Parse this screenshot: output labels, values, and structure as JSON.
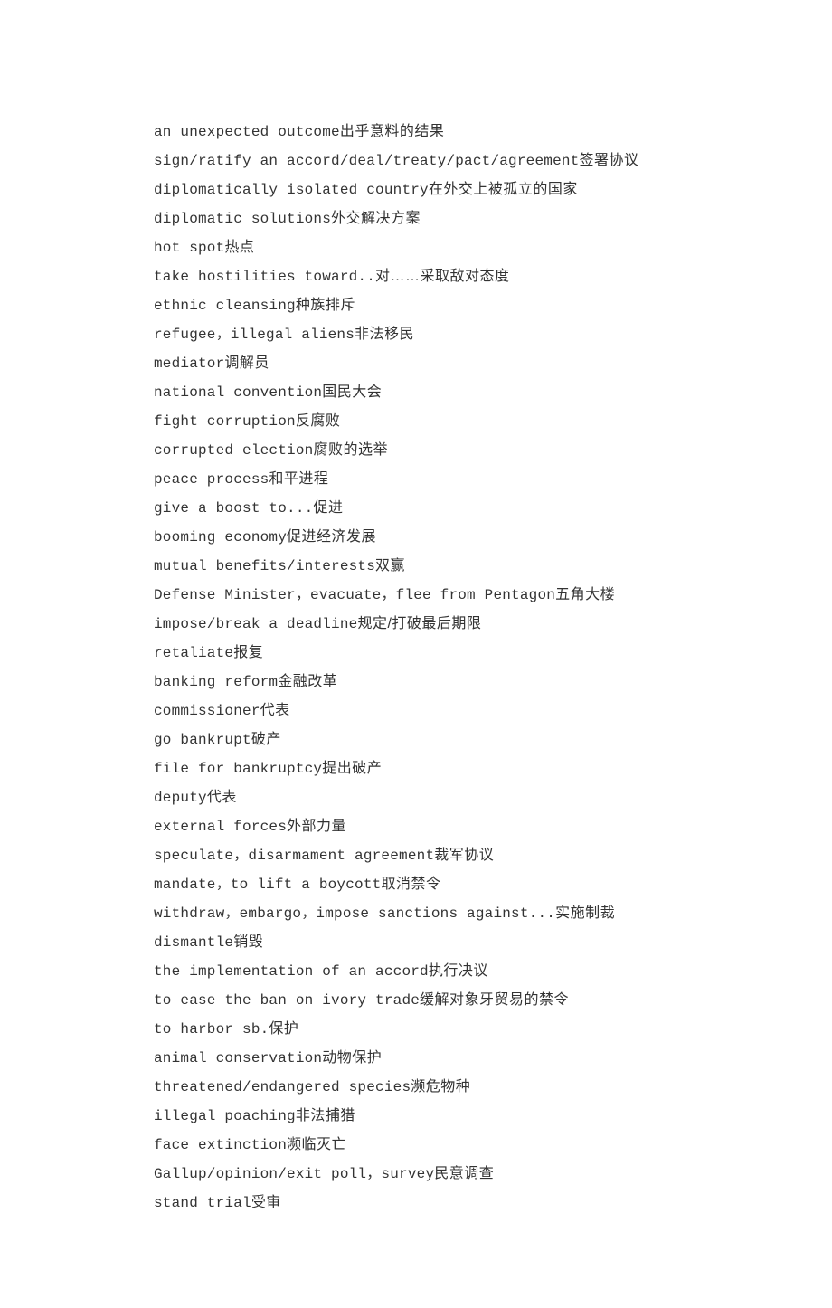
{
  "vocabulary": [
    {
      "en": "an unexpected outcome",
      "zh": "出乎意料的结果"
    },
    {
      "en": "sign/ratify an accord/deal/treaty/pact/agreement",
      "zh": "签署协议"
    },
    {
      "en": "diplomatically isolated country",
      "zh": "在外交上被孤立的国家"
    },
    {
      "en": "diplomatic solutions",
      "zh": "外交解决方案"
    },
    {
      "en": "hot spot",
      "zh": "热点"
    },
    {
      "en": "take hostilities toward..",
      "zh": "对……采取敌对态度"
    },
    {
      "en": "ethnic cleansing",
      "zh": "种族排斥"
    },
    {
      "en": "refugee，illegal aliens",
      "zh": "非法移民"
    },
    {
      "en": "mediator",
      "zh": "调解员"
    },
    {
      "en": "national convention",
      "zh": "国民大会"
    },
    {
      "en": "fight corruption",
      "zh": "反腐败"
    },
    {
      "en": "corrupted election",
      "zh": "腐败的选举"
    },
    {
      "en": "peace process",
      "zh": "和平进程"
    },
    {
      "en": "give a boost to...",
      "zh": "促进"
    },
    {
      "en": "booming economy",
      "zh": "促进经济发展"
    },
    {
      "en": "mutual benefits/interests",
      "zh": "双赢"
    },
    {
      "en": "Defense Minister，evacuate，flee from Pentagon",
      "zh": "五角大楼"
    },
    {
      "en": "impose/break a deadline",
      "zh": "规定/打破最后期限"
    },
    {
      "en": "retaliate",
      "zh": "报复"
    },
    {
      "en": "banking reform",
      "zh": "金融改革"
    },
    {
      "en": "commissioner",
      "zh": "代表"
    },
    {
      "en": "go bankrupt",
      "zh": "破产"
    },
    {
      "en": "file for bankruptcy",
      "zh": "提出破产"
    },
    {
      "en": "deputy",
      "zh": "代表"
    },
    {
      "en": "external forces",
      "zh": "外部力量"
    },
    {
      "en": "speculate，disarmament agreement",
      "zh": "裁军协议"
    },
    {
      "en": "mandate，to lift a boycott",
      "zh": "取消禁令"
    },
    {
      "en": "withdraw，embargo，impose sanctions against...",
      "zh": "实施制裁"
    },
    {
      "en": "dismantle",
      "zh": "销毁"
    },
    {
      "en": "the implementation of an accord",
      "zh": "执行决议"
    },
    {
      "en": "to ease the ban on ivory trade",
      "zh": "缓解对象牙贸易的禁令"
    },
    {
      "en": "to harbor sb.",
      "zh": "保护"
    },
    {
      "en": "animal conservation",
      "zh": "动物保护"
    },
    {
      "en": "threatened/endangered species",
      "zh": "濒危物种"
    },
    {
      "en": "illegal poaching",
      "zh": "非法捕猎"
    },
    {
      "en": "face extinction",
      "zh": "濒临灭亡"
    },
    {
      "en": "Gallup/opinion/exit poll，survey",
      "zh": "民意调查"
    },
    {
      "en": "stand trial",
      "zh": "受审"
    }
  ]
}
